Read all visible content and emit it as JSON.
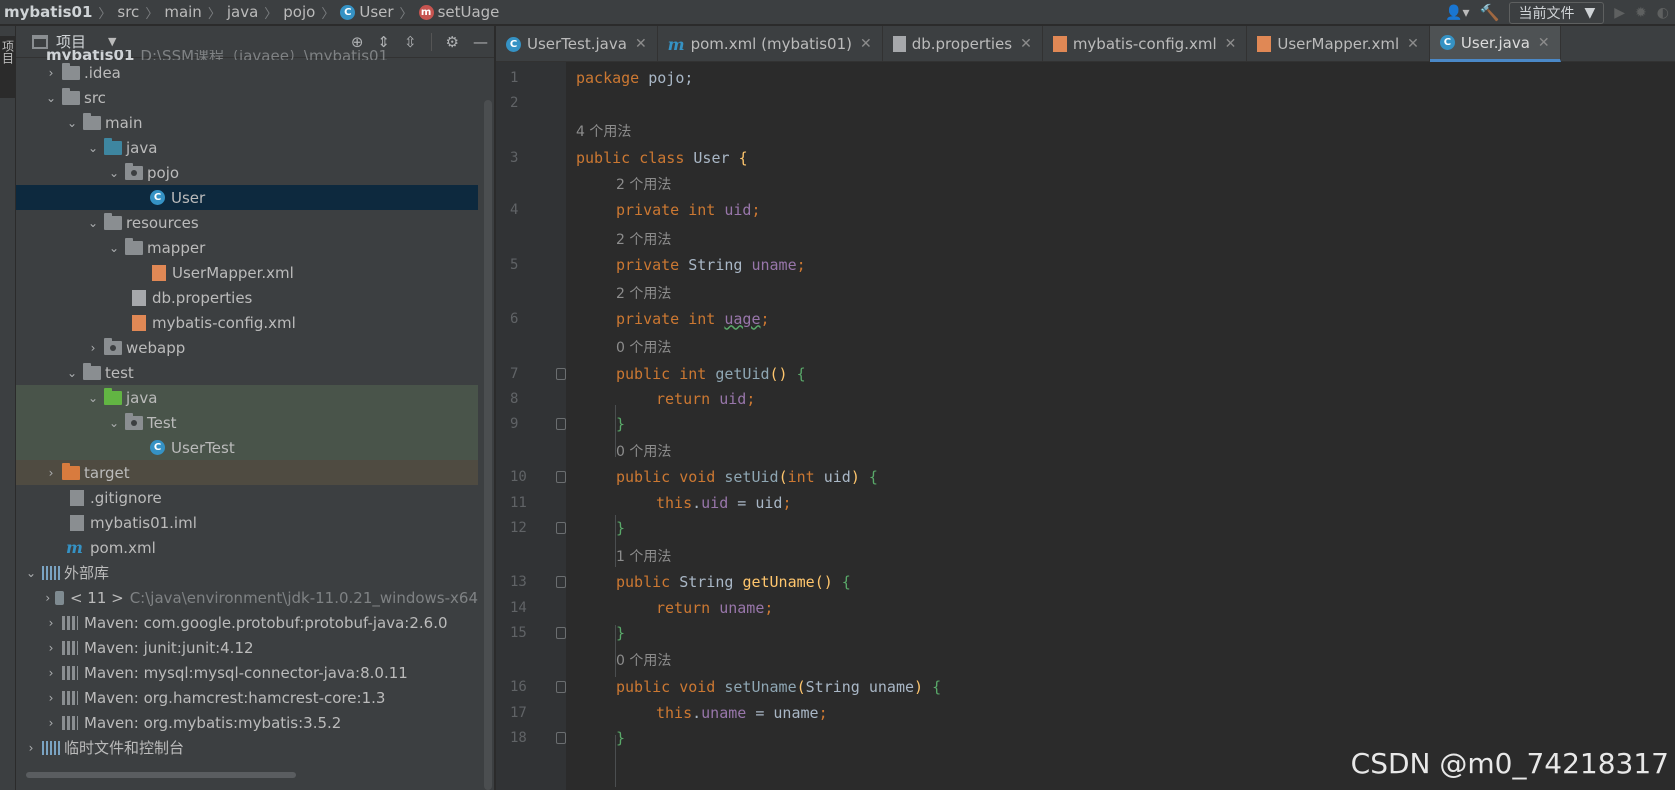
{
  "breadcrumb": {
    "items": [
      "mybatis01",
      "src",
      "main",
      "java",
      "pojo",
      "User",
      "setUage"
    ]
  },
  "toolbar": {
    "run_config": "当前文件"
  },
  "toolstrip": {
    "project_tab": "项目"
  },
  "project_panel": {
    "title": "项目",
    "tree": [
      {
        "label": "mybatis01",
        "hint": "D:\\SSM课程（javaee）\\mybatis01"
      },
      {
        "label": ".idea"
      },
      {
        "label": "src"
      },
      {
        "label": "main"
      },
      {
        "label": "java"
      },
      {
        "label": "pojo"
      },
      {
        "label": "User"
      },
      {
        "label": "resources"
      },
      {
        "label": "mapper"
      },
      {
        "label": "UserMapper.xml"
      },
      {
        "label": "db.properties"
      },
      {
        "label": "mybatis-config.xml"
      },
      {
        "label": "webapp"
      },
      {
        "label": "test"
      },
      {
        "label": "java"
      },
      {
        "label": "Test"
      },
      {
        "label": "UserTest"
      },
      {
        "label": "target"
      },
      {
        "label": ".gitignore"
      },
      {
        "label": "mybatis01.iml"
      },
      {
        "label": "pom.xml"
      },
      {
        "label": "外部库"
      },
      {
        "label": "< 11 >",
        "hint": "C:\\java\\environment\\jdk-11.0.21_windows-x64"
      },
      {
        "label": "Maven: com.google.protobuf:protobuf-java:2.6.0"
      },
      {
        "label": "Maven: junit:junit:4.12"
      },
      {
        "label": "Maven: mysql:mysql-connector-java:8.0.11"
      },
      {
        "label": "Maven: org.hamcrest:hamcrest-core:1.3"
      },
      {
        "label": "Maven: org.mybatis:mybatis:3.5.2"
      },
      {
        "label": "临时文件和控制台"
      }
    ]
  },
  "tabs": [
    {
      "label": "UserTest.java",
      "icon": "class-icon"
    },
    {
      "label": "pom.xml (mybatis01)",
      "icon": "maven-icon"
    },
    {
      "label": "db.properties",
      "icon": "properties-icon"
    },
    {
      "label": "mybatis-config.xml",
      "icon": "xml-icon"
    },
    {
      "label": "UserMapper.xml",
      "icon": "xml-icon"
    },
    {
      "label": "User.java",
      "icon": "class-icon",
      "active": true
    }
  ],
  "code": {
    "line_numbers": [
      "1",
      "2",
      "3",
      "4",
      "5",
      "6",
      "7",
      "8",
      "9",
      "10",
      "11",
      "12",
      "13",
      "14",
      "15",
      "16",
      "17",
      "18"
    ],
    "usages": {
      "class": "4 个用法",
      "uid": "2 个用法",
      "uname": "2 个用法",
      "uage": "2 个用法",
      "getUid": "0 个用法",
      "setUid": "0 个用法",
      "getUname": "1 个用法",
      "setUname": "0 个用法"
    },
    "tokens": {
      "package": "package",
      "pkgname": "pojo;",
      "public": "public",
      "class": "class",
      "className": "User",
      "brace_open": "{",
      "brace_close": "}",
      "private": "private",
      "int": "int",
      "String": "String",
      "void": "void",
      "return": "return",
      "this": "this",
      "uid": "uid",
      "uname": "uname",
      "uage": "uage",
      "semi": ";",
      "getUid": "getUid",
      "setUid": "setUid",
      "getUname": "getUname",
      "setUname": "setUname",
      "parens": "()",
      "p_open": "(",
      "p_close": ")",
      "dot": ".",
      "eq": " = ",
      "space": " "
    }
  },
  "watermark": "CSDN @m0_74218317"
}
